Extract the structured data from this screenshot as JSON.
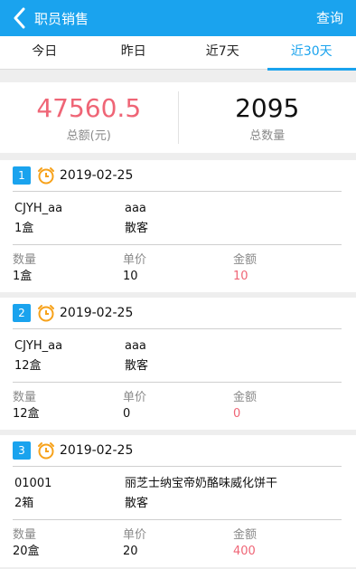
{
  "header": {
    "title": "职员销售",
    "action": "查询"
  },
  "tabs": [
    {
      "label": "今日",
      "active": false
    },
    {
      "label": "昨日",
      "active": false
    },
    {
      "label": "近7天",
      "active": false
    },
    {
      "label": "近30天",
      "active": true
    }
  ],
  "summary": {
    "amount": "47560.5",
    "amount_label": "总额(元)",
    "quantity": "2095",
    "quantity_label": "总数量"
  },
  "labels": {
    "qty": "数量",
    "price": "单价",
    "total": "金额"
  },
  "records": [
    {
      "index": "1",
      "date": "2019-02-25",
      "code": "CJYH_aa",
      "name": "aaa",
      "unit": "1盒",
      "customer": "散客",
      "qty": "1盒",
      "price": "10",
      "total": "10"
    },
    {
      "index": "2",
      "date": "2019-02-25",
      "code": "CJYH_aa",
      "name": "aaa",
      "unit": "12盒",
      "customer": "散客",
      "qty": "12盒",
      "price": "0",
      "total": "0"
    },
    {
      "index": "3",
      "date": "2019-02-25",
      "code": "01001",
      "name": "丽芝士纳宝帝奶酪味威化饼干",
      "unit": "2箱",
      "customer": "散客",
      "qty": "20盒",
      "price": "20",
      "total": "400"
    }
  ],
  "colors": {
    "primary": "#1aa3ee",
    "accent_red": "#ef6576",
    "clock": "#f7a21b"
  }
}
